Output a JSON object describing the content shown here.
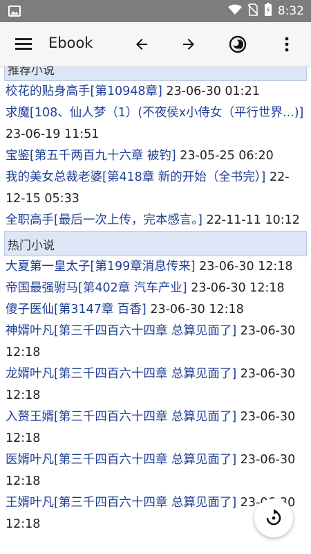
{
  "status_bar": {
    "time": "8:32"
  },
  "app_bar": {
    "title": "Ebook"
  },
  "sections": [
    {
      "header": "推荐小说",
      "items": [
        {
          "title": "校花的贴身高手",
          "chapter": "[第10948章]",
          "time": "23-06-30 01:21"
        },
        {
          "title": "求魔",
          "chapter": "[108、仙人梦（1）(不夜侯x小侍女（平行世界...)]",
          "time": "23-06-19 11:51"
        },
        {
          "title": "宝鉴",
          "chapter": "[第五千两百九十六章 被钓]",
          "time": "23-05-25 06:20"
        },
        {
          "title": "我的美女总裁老婆",
          "chapter": "[第418章 新的开始（全书完）]",
          "time": "22-12-15 05:33"
        },
        {
          "title": "全职高手",
          "chapter": "[最后一次上传，完本感言。]",
          "time": "22-11-11 10:12"
        }
      ]
    },
    {
      "header": "热门小说",
      "items": [
        {
          "title": "大夏第一皇太子",
          "chapter": "[第199章消息传来]",
          "time": "23-06-30 12:18"
        },
        {
          "title": "帝国最强驸马",
          "chapter": "[第402章 汽车产业]",
          "time": "23-06-30 12:18"
        },
        {
          "title": "傻子医仙",
          "chapter": "[第3147章 百香]",
          "time": "23-06-30 12:18"
        },
        {
          "title": "神婿叶凡",
          "chapter": "[第三千四百六十四章 总算见面了]",
          "time": "23-06-30 12:18"
        },
        {
          "title": "龙婿叶凡",
          "chapter": "[第三千四百六十四章 总算见面了]",
          "time": "23-06-30 12:18"
        },
        {
          "title": "入赘王婿",
          "chapter": "[第三千四百六十四章 总算见面了]",
          "time": "23-06-30 12:18"
        },
        {
          "title": "医婿叶凡",
          "chapter": "[第三千四百六十四章 总算见面了]",
          "time": "23-06-30 12:18"
        },
        {
          "title": "王婿叶凡",
          "chapter": "[第三千四百六十四章 总算见面了]",
          "time": "23-06-30 12:18"
        }
      ]
    }
  ],
  "icons": {
    "menu": "hamburger-icon",
    "back": "arrow-left-icon",
    "forward": "arrow-right-icon",
    "night_mode": "night-mode-icon",
    "overflow": "more-vert-icon",
    "fab": "refresh-icon"
  },
  "colors": {
    "link": "#1f3f95",
    "section_bg": "#dce6f6"
  }
}
